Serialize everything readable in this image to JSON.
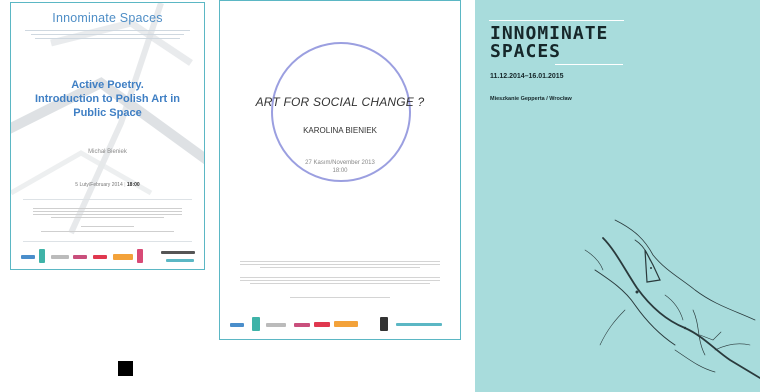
{
  "poster1": {
    "header": "Innominate Spaces",
    "title_lines": [
      "Active Poetry.",
      "Introduction to Polish Art in",
      "Public Space"
    ],
    "author": "Michał Bieniek",
    "date": "5 Luty/February 2014",
    "time": "18:00"
  },
  "poster2": {
    "title": "ART FOR SOCIAL CHANGE ?",
    "author": "KAROLINA BIENIEK",
    "date": "27 Kasım/November 2013",
    "time": "18:00"
  },
  "poster3": {
    "title_line1": "INNOMINATE",
    "title_line2": "SPACES",
    "dates": "11.12.2014–16.01.2015",
    "venue": "Mieszkanie Gepperta / Wrocław"
  },
  "colors": {
    "poster_border": "#5bb7c4",
    "poster1_title": "#3f7fc4",
    "poster2_circle": "#9b9fe0",
    "poster3_bg": "#a8dcdc"
  }
}
